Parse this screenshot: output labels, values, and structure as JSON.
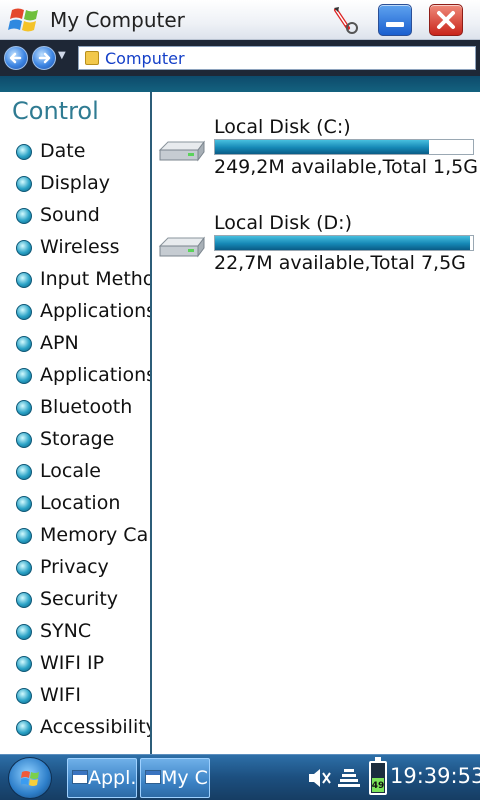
{
  "window": {
    "title": "My Computer"
  },
  "address": {
    "path": "Computer"
  },
  "sidebar": {
    "title": "Control",
    "items": [
      {
        "label": "Date"
      },
      {
        "label": "Display"
      },
      {
        "label": "Sound"
      },
      {
        "label": "Wireless"
      },
      {
        "label": "Input Metho"
      },
      {
        "label": "Applications"
      },
      {
        "label": "APN"
      },
      {
        "label": "Applications"
      },
      {
        "label": "Bluetooth"
      },
      {
        "label": "Storage"
      },
      {
        "label": "Locale"
      },
      {
        "label": "Location"
      },
      {
        "label": "Memory Card"
      },
      {
        "label": "Privacy"
      },
      {
        "label": "Security"
      },
      {
        "label": "SYNC"
      },
      {
        "label": "WIFI IP"
      },
      {
        "label": "WIFI"
      },
      {
        "label": "Accessibility"
      }
    ]
  },
  "disks": [
    {
      "name": "Local Disk (C:)",
      "info": "249,2M available,Total 1,5G",
      "used_fraction": 0.83
    },
    {
      "name": "Local Disk (D:)",
      "info": "22,7M available,Total 7,5G",
      "used_fraction": 0.99
    }
  ],
  "taskbar": {
    "tasks": [
      {
        "label": "Appl."
      },
      {
        "label": "My C"
      }
    ],
    "battery": "49",
    "clock": "19:39:53"
  },
  "colors": {
    "accent": "#14627f",
    "progress": "#1587b5",
    "panel_title": "#2f7b92",
    "address_link": "#1540c8"
  },
  "icons": {
    "app": "windows-logo-icon",
    "tool": "pen-tool-icon",
    "minimize": "minimize-icon",
    "close": "close-icon",
    "back": "back-arrow-icon",
    "forward": "forward-arrow-icon",
    "folder": "folder-icon",
    "menu_bullet": "orb-bullet-icon",
    "disk": "hard-drive-icon",
    "start": "start-orb-icon",
    "volume": "speaker-mute-icon",
    "network": "signal-icon",
    "battery": "battery-icon"
  }
}
